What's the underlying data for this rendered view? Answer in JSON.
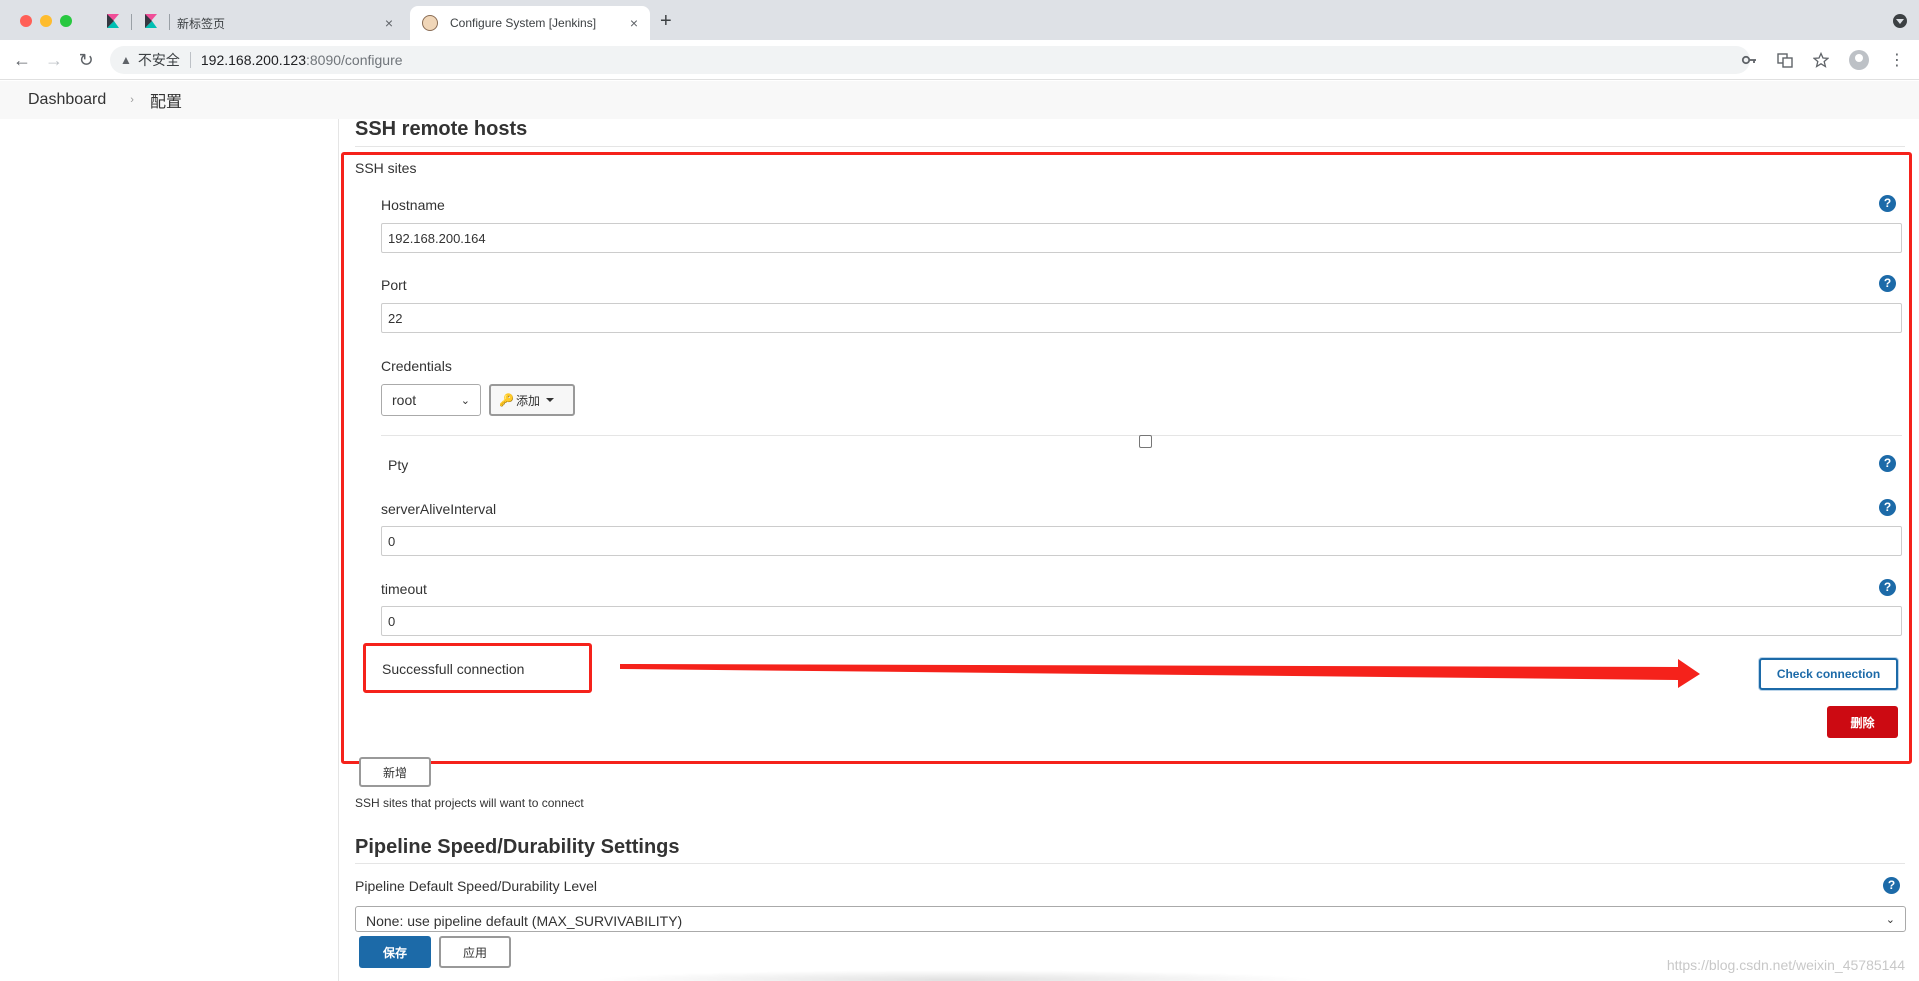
{
  "browser": {
    "tabs": [
      {
        "title": "新标签页",
        "close": "×"
      },
      {
        "title": "Configure System [Jenkins]",
        "close": "×"
      }
    ],
    "new_tab": "+",
    "insecure_label": "不安全",
    "url_host": "192.168.200.123",
    "url_path": ":8090/configure"
  },
  "breadcrumb": {
    "items": [
      "Dashboard",
      "配置"
    ],
    "separator": "›"
  },
  "ssh_remote_hosts": {
    "title": "SSH remote hosts",
    "sites_label": "SSH sites",
    "hostname_label": "Hostname",
    "hostname_value": "192.168.200.164",
    "port_label": "Port",
    "port_value": "22",
    "credentials_label": "Credentials",
    "credentials_selected": "root",
    "add_label": "添加",
    "pty_label": "Pty",
    "pty_checked": false,
    "server_alive_label": "serverAliveInterval",
    "server_alive_value": "0",
    "timeout_label": "timeout",
    "timeout_value": "0",
    "status_text": "Successfull connection",
    "check_button": "Check connection",
    "delete_button": "删除",
    "add_site_button": "新增",
    "sites_hint": "SSH sites that projects will want to connect"
  },
  "pipeline": {
    "title": "Pipeline Speed/Durability Settings",
    "level_label": "Pipeline Default Speed/Durability Level",
    "level_value": "None: use pipeline default (MAX_SURVIVABILITY)"
  },
  "footer": {
    "save_button": "保存",
    "apply_button": "应用"
  },
  "help_symbol": "?",
  "watermark": "https://blog.csdn.net/weixin_45785144",
  "colors": {
    "accent": "#1c6aa8",
    "danger": "#cc0a12",
    "annotation": "#f5221b"
  }
}
